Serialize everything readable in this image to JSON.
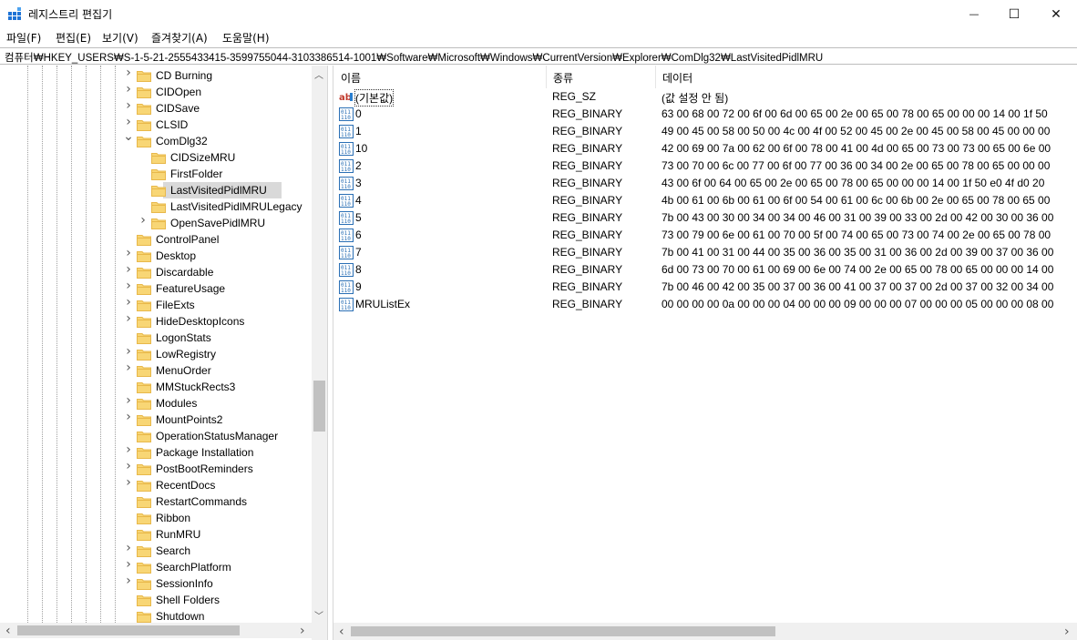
{
  "window": {
    "title": "레지스트리 편집기",
    "minimize_icon": "minimize-icon",
    "maximize_icon": "maximize-icon",
    "close_icon": "close-icon",
    "minimize_glyph": "—",
    "maximize_glyph": "☐",
    "close_glyph": "✕"
  },
  "menu": [
    "파일(F)",
    "편집(E)",
    "보기(V)",
    "즐겨찾기(A)",
    "도움말(H)"
  ],
  "address": "컴퓨터₩HKEY_USERS₩S-1-5-21-2555433415-3599755044-3103386514-1001₩Software₩Microsoft₩Windows₩CurrentVersion₩Explorer₩ComDlg32₩LastVisitedPidlMRU",
  "tree": {
    "items": [
      {
        "label": "CD Burning",
        "expander": "collapsed",
        "level": 0
      },
      {
        "label": "CIDOpen",
        "expander": "collapsed",
        "level": 0
      },
      {
        "label": "CIDSave",
        "expander": "collapsed",
        "level": 0
      },
      {
        "label": "CLSID",
        "expander": "collapsed",
        "level": 0
      },
      {
        "label": "ComDlg32",
        "expander": "expanded",
        "level": 0
      },
      {
        "label": "CIDSizeMRU",
        "expander": "none",
        "level": 1
      },
      {
        "label": "FirstFolder",
        "expander": "none",
        "level": 1
      },
      {
        "label": "LastVisitedPidlMRU",
        "expander": "none",
        "level": 1,
        "selected": true
      },
      {
        "label": "LastVisitedPidlMRULegacy",
        "expander": "none",
        "level": 1
      },
      {
        "label": "OpenSavePidlMRU",
        "expander": "collapsed",
        "level": 1
      },
      {
        "label": "ControlPanel",
        "expander": "none",
        "level": 0
      },
      {
        "label": "Desktop",
        "expander": "collapsed",
        "level": 0
      },
      {
        "label": "Discardable",
        "expander": "collapsed",
        "level": 0
      },
      {
        "label": "FeatureUsage",
        "expander": "collapsed",
        "level": 0
      },
      {
        "label": "FileExts",
        "expander": "collapsed",
        "level": 0
      },
      {
        "label": "HideDesktopIcons",
        "expander": "collapsed",
        "level": 0
      },
      {
        "label": "LogonStats",
        "expander": "none",
        "level": 0
      },
      {
        "label": "LowRegistry",
        "expander": "collapsed",
        "level": 0
      },
      {
        "label": "MenuOrder",
        "expander": "collapsed",
        "level": 0
      },
      {
        "label": "MMStuckRects3",
        "expander": "none",
        "level": 0
      },
      {
        "label": "Modules",
        "expander": "collapsed",
        "level": 0
      },
      {
        "label": "MountPoints2",
        "expander": "collapsed",
        "level": 0
      },
      {
        "label": "OperationStatusManager",
        "expander": "none",
        "level": 0
      },
      {
        "label": "Package Installation",
        "expander": "collapsed",
        "level": 0
      },
      {
        "label": "PostBootReminders",
        "expander": "collapsed",
        "level": 0
      },
      {
        "label": "RecentDocs",
        "expander": "collapsed",
        "level": 0
      },
      {
        "label": "RestartCommands",
        "expander": "none",
        "level": 0
      },
      {
        "label": "Ribbon",
        "expander": "none",
        "level": 0
      },
      {
        "label": "RunMRU",
        "expander": "none",
        "level": 0
      },
      {
        "label": "Search",
        "expander": "collapsed",
        "level": 0
      },
      {
        "label": "SearchPlatform",
        "expander": "collapsed",
        "level": 0
      },
      {
        "label": "SessionInfo",
        "expander": "collapsed",
        "level": 0
      },
      {
        "label": "Shell Folders",
        "expander": "none",
        "level": 0
      },
      {
        "label": "Shutdown",
        "expander": "none",
        "level": 0
      }
    ]
  },
  "list": {
    "columns": [
      "이름",
      "종류",
      "데이터"
    ],
    "rows": [
      {
        "name": "(기본값)",
        "type": "REG_SZ",
        "data": "(값 설정 안 됨)",
        "icon": "string-value-icon",
        "focused": true
      },
      {
        "name": "0",
        "type": "REG_BINARY",
        "data": "63 00 68 00 72 00 6f 00 6d 00 65 00 2e 00 65 00 78 00 65 00 00 00 14 00 1f 50",
        "icon": "binary-value-icon"
      },
      {
        "name": "1",
        "type": "REG_BINARY",
        "data": "49 00 45 00 58 00 50 00 4c 00 4f 00 52 00 45 00 2e 00 45 00 58 00 45 00 00 00",
        "icon": "binary-value-icon"
      },
      {
        "name": "10",
        "type": "REG_BINARY",
        "data": "42 00 69 00 7a 00 62 00 6f 00 78 00 41 00 4d 00 65 00 73 00 73 00 65 00 6e 00",
        "icon": "binary-value-icon"
      },
      {
        "name": "2",
        "type": "REG_BINARY",
        "data": "73 00 70 00 6c 00 77 00 6f 00 77 00 36 00 34 00 2e 00 65 00 78 00 65 00 00 00",
        "icon": "binary-value-icon"
      },
      {
        "name": "3",
        "type": "REG_BINARY",
        "data": "43 00 6f 00 64 00 65 00 2e 00 65 00 78 00 65 00 00 00 14 00 1f 50 e0 4f d0 20",
        "icon": "binary-value-icon"
      },
      {
        "name": "4",
        "type": "REG_BINARY",
        "data": "4b 00 61 00 6b 00 61 00 6f 00 54 00 61 00 6c 00 6b 00 2e 00 65 00 78 00 65 00",
        "icon": "binary-value-icon"
      },
      {
        "name": "5",
        "type": "REG_BINARY",
        "data": "7b 00 43 00 30 00 34 00 34 00 46 00 31 00 39 00 33 00 2d 00 42 00 30 00 36 00",
        "icon": "binary-value-icon"
      },
      {
        "name": "6",
        "type": "REG_BINARY",
        "data": "73 00 79 00 6e 00 61 00 70 00 5f 00 74 00 65 00 73 00 74 00 2e 00 65 00 78 00",
        "icon": "binary-value-icon"
      },
      {
        "name": "7",
        "type": "REG_BINARY",
        "data": "7b 00 41 00 31 00 44 00 35 00 36 00 35 00 31 00 36 00 2d 00 39 00 37 00 36 00",
        "icon": "binary-value-icon"
      },
      {
        "name": "8",
        "type": "REG_BINARY",
        "data": "6d 00 73 00 70 00 61 00 69 00 6e 00 74 00 2e 00 65 00 78 00 65 00 00 00 14 00",
        "icon": "binary-value-icon"
      },
      {
        "name": "9",
        "type": "REG_BINARY",
        "data": "7b 00 46 00 42 00 35 00 37 00 36 00 41 00 37 00 37 00 2d 00 37 00 32 00 34 00",
        "icon": "binary-value-icon"
      },
      {
        "name": "MRUListEx",
        "type": "REG_BINARY",
        "data": "00 00 00 00 0a 00 00 00 04 00 00 00 09 00 00 00 07 00 00 00 05 00 00 00 08 00",
        "icon": "binary-value-icon"
      }
    ]
  },
  "scrollbars": {
    "tree_vertical_position": 0.57,
    "tree_horizontal_position": 0.0,
    "list_horizontal_position": 0.0,
    "arrow_up": "︿",
    "arrow_down": "﹀",
    "arrow_left": "‹",
    "arrow_right": "›"
  },
  "colors": {
    "folder": "#f8d675",
    "folder_dark": "#e8b84a",
    "selection": "#d9d9d9",
    "app_icon_blue": "#1e73d6"
  }
}
